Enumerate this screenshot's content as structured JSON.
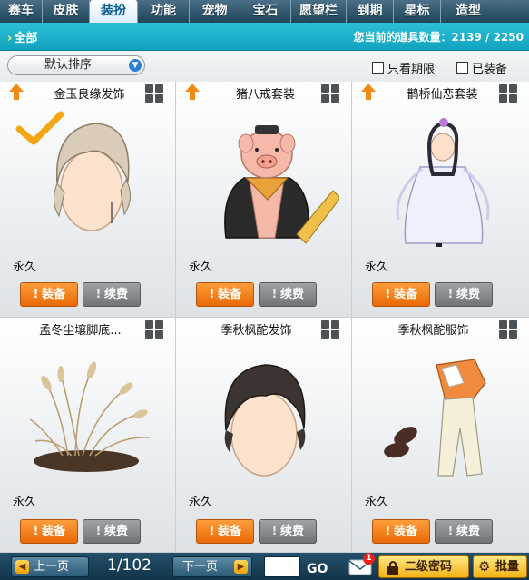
{
  "tabs": [
    "赛车",
    "皮肤",
    "装扮",
    "功能",
    "宠物",
    "宝石",
    "愿望栏",
    "到期",
    "星标",
    "造型"
  ],
  "active_tab": 2,
  "subbar": {
    "category": "全部",
    "count_label": "您当前的道具数量：",
    "count": "2139 / 2250"
  },
  "filter": {
    "sort_label": "默认排序",
    "only_expiring": "只看期限",
    "equipped": "已装备"
  },
  "items": [
    {
      "name": "金玉良缘发饰",
      "duration": "永久",
      "equip": "装备",
      "renew": "续费",
      "upgradable": true,
      "selected": true
    },
    {
      "name": "猪八戒套装",
      "duration": "永久",
      "equip": "装备",
      "renew": "续费",
      "upgradable": true,
      "selected": false
    },
    {
      "name": "鹊桥仙恋套装",
      "duration": "永久",
      "equip": "装备",
      "renew": "续费",
      "upgradable": true,
      "selected": false
    },
    {
      "name": "孟冬尘壤脚底...",
      "duration": "永久",
      "equip": "装备",
      "renew": "续费",
      "upgradable": false,
      "selected": false
    },
    {
      "name": "季秋枫酡发饰",
      "duration": "永久",
      "equip": "装备",
      "renew": "续费",
      "upgradable": false,
      "selected": false
    },
    {
      "name": "季秋枫酡服饰",
      "duration": "永久",
      "equip": "装备",
      "renew": "续费",
      "upgradable": false,
      "selected": false
    }
  ],
  "pagination": {
    "prev": "上一页",
    "next": "下一页",
    "page": "1/102",
    "go": "GO"
  },
  "mail_badge": "1",
  "password_button": "二级密码",
  "bulk_button": "批量",
  "icons": {
    "category_arrow": "chevron-right-icon",
    "sort_dropdown": "chevron-down-icon",
    "upgrade": "up-arrow-icon",
    "detail": "grid-icon",
    "mail": "envelope-icon",
    "lock": "lock-icon",
    "gear": "gear-icon"
  }
}
